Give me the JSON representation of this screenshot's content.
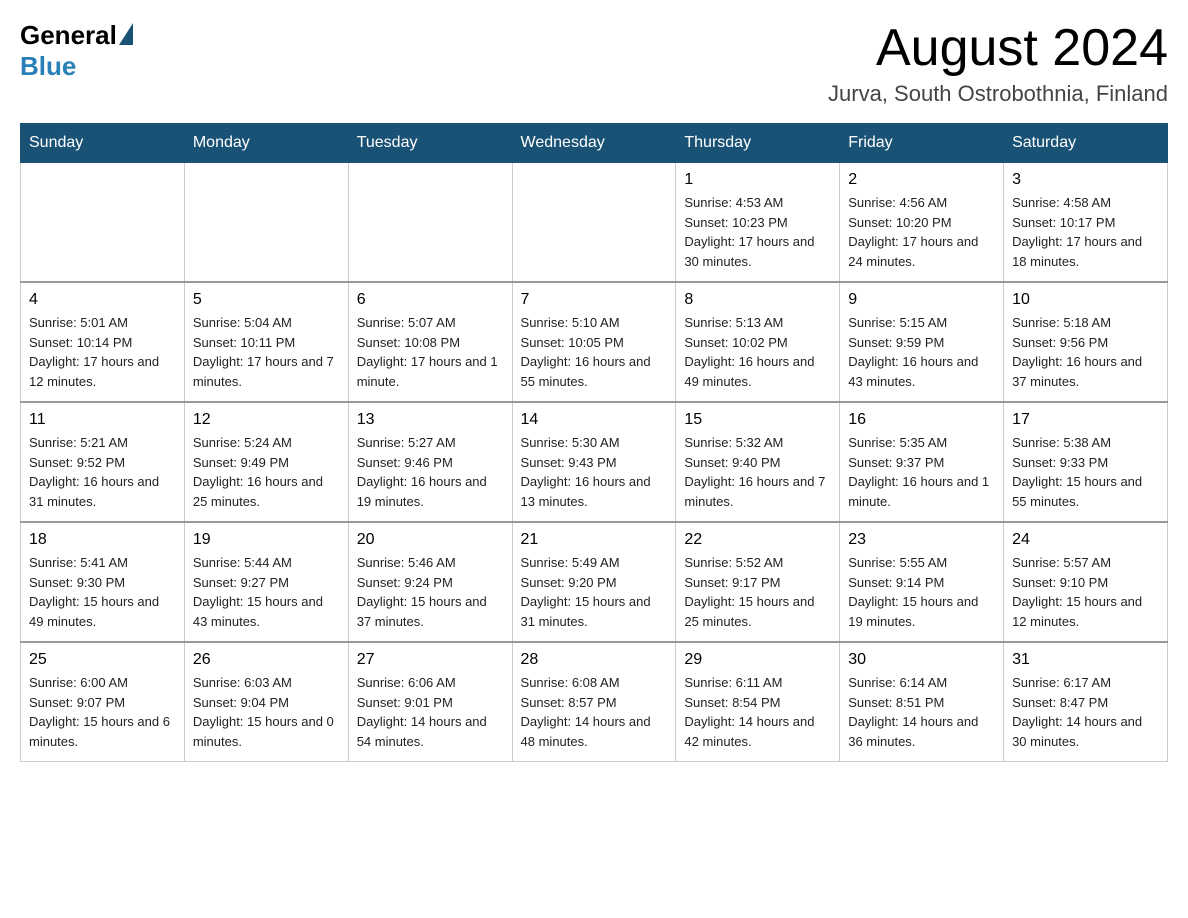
{
  "header": {
    "logo_general": "General",
    "logo_blue": "Blue",
    "month_title": "August 2024",
    "location": "Jurva, South Ostrobothnia, Finland"
  },
  "days_of_week": [
    "Sunday",
    "Monday",
    "Tuesday",
    "Wednesday",
    "Thursday",
    "Friday",
    "Saturday"
  ],
  "weeks": [
    [
      {
        "day": "",
        "info": ""
      },
      {
        "day": "",
        "info": ""
      },
      {
        "day": "",
        "info": ""
      },
      {
        "day": "",
        "info": ""
      },
      {
        "day": "1",
        "info": "Sunrise: 4:53 AM\nSunset: 10:23 PM\nDaylight: 17 hours and 30 minutes."
      },
      {
        "day": "2",
        "info": "Sunrise: 4:56 AM\nSunset: 10:20 PM\nDaylight: 17 hours and 24 minutes."
      },
      {
        "day": "3",
        "info": "Sunrise: 4:58 AM\nSunset: 10:17 PM\nDaylight: 17 hours and 18 minutes."
      }
    ],
    [
      {
        "day": "4",
        "info": "Sunrise: 5:01 AM\nSunset: 10:14 PM\nDaylight: 17 hours and 12 minutes."
      },
      {
        "day": "5",
        "info": "Sunrise: 5:04 AM\nSunset: 10:11 PM\nDaylight: 17 hours and 7 minutes."
      },
      {
        "day": "6",
        "info": "Sunrise: 5:07 AM\nSunset: 10:08 PM\nDaylight: 17 hours and 1 minute."
      },
      {
        "day": "7",
        "info": "Sunrise: 5:10 AM\nSunset: 10:05 PM\nDaylight: 16 hours and 55 minutes."
      },
      {
        "day": "8",
        "info": "Sunrise: 5:13 AM\nSunset: 10:02 PM\nDaylight: 16 hours and 49 minutes."
      },
      {
        "day": "9",
        "info": "Sunrise: 5:15 AM\nSunset: 9:59 PM\nDaylight: 16 hours and 43 minutes."
      },
      {
        "day": "10",
        "info": "Sunrise: 5:18 AM\nSunset: 9:56 PM\nDaylight: 16 hours and 37 minutes."
      }
    ],
    [
      {
        "day": "11",
        "info": "Sunrise: 5:21 AM\nSunset: 9:52 PM\nDaylight: 16 hours and 31 minutes."
      },
      {
        "day": "12",
        "info": "Sunrise: 5:24 AM\nSunset: 9:49 PM\nDaylight: 16 hours and 25 minutes."
      },
      {
        "day": "13",
        "info": "Sunrise: 5:27 AM\nSunset: 9:46 PM\nDaylight: 16 hours and 19 minutes."
      },
      {
        "day": "14",
        "info": "Sunrise: 5:30 AM\nSunset: 9:43 PM\nDaylight: 16 hours and 13 minutes."
      },
      {
        "day": "15",
        "info": "Sunrise: 5:32 AM\nSunset: 9:40 PM\nDaylight: 16 hours and 7 minutes."
      },
      {
        "day": "16",
        "info": "Sunrise: 5:35 AM\nSunset: 9:37 PM\nDaylight: 16 hours and 1 minute."
      },
      {
        "day": "17",
        "info": "Sunrise: 5:38 AM\nSunset: 9:33 PM\nDaylight: 15 hours and 55 minutes."
      }
    ],
    [
      {
        "day": "18",
        "info": "Sunrise: 5:41 AM\nSunset: 9:30 PM\nDaylight: 15 hours and 49 minutes."
      },
      {
        "day": "19",
        "info": "Sunrise: 5:44 AM\nSunset: 9:27 PM\nDaylight: 15 hours and 43 minutes."
      },
      {
        "day": "20",
        "info": "Sunrise: 5:46 AM\nSunset: 9:24 PM\nDaylight: 15 hours and 37 minutes."
      },
      {
        "day": "21",
        "info": "Sunrise: 5:49 AM\nSunset: 9:20 PM\nDaylight: 15 hours and 31 minutes."
      },
      {
        "day": "22",
        "info": "Sunrise: 5:52 AM\nSunset: 9:17 PM\nDaylight: 15 hours and 25 minutes."
      },
      {
        "day": "23",
        "info": "Sunrise: 5:55 AM\nSunset: 9:14 PM\nDaylight: 15 hours and 19 minutes."
      },
      {
        "day": "24",
        "info": "Sunrise: 5:57 AM\nSunset: 9:10 PM\nDaylight: 15 hours and 12 minutes."
      }
    ],
    [
      {
        "day": "25",
        "info": "Sunrise: 6:00 AM\nSunset: 9:07 PM\nDaylight: 15 hours and 6 minutes."
      },
      {
        "day": "26",
        "info": "Sunrise: 6:03 AM\nSunset: 9:04 PM\nDaylight: 15 hours and 0 minutes."
      },
      {
        "day": "27",
        "info": "Sunrise: 6:06 AM\nSunset: 9:01 PM\nDaylight: 14 hours and 54 minutes."
      },
      {
        "day": "28",
        "info": "Sunrise: 6:08 AM\nSunset: 8:57 PM\nDaylight: 14 hours and 48 minutes."
      },
      {
        "day": "29",
        "info": "Sunrise: 6:11 AM\nSunset: 8:54 PM\nDaylight: 14 hours and 42 minutes."
      },
      {
        "day": "30",
        "info": "Sunrise: 6:14 AM\nSunset: 8:51 PM\nDaylight: 14 hours and 36 minutes."
      },
      {
        "day": "31",
        "info": "Sunrise: 6:17 AM\nSunset: 8:47 PM\nDaylight: 14 hours and 30 minutes."
      }
    ]
  ]
}
